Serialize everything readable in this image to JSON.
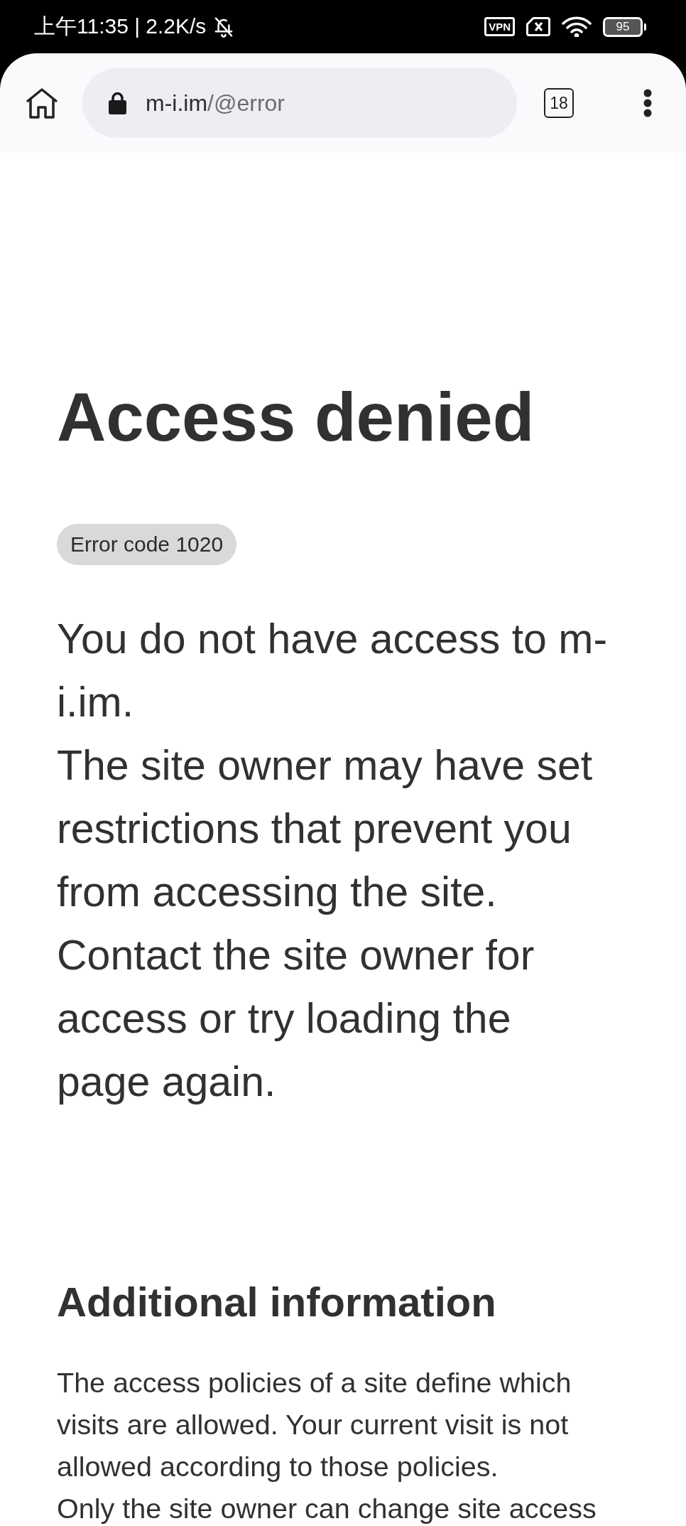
{
  "status_bar": {
    "time": "上午11:35 | 2.2K/s",
    "vpn_label": "VPN",
    "battery": "95"
  },
  "toolbar": {
    "url": {
      "host": "m-i.im",
      "path": "/@error"
    },
    "tab_count": "18"
  },
  "page": {
    "title": "Access denied",
    "error_code": "Error code 1020",
    "message": [
      "You do not have access to m-i.im.",
      "The site owner may have set restrictions that prevent you from accessing the site.",
      "Contact the site owner for access or try loading the page again."
    ]
  },
  "additional": {
    "heading": "Additional information",
    "paragraphs": [
      "The access policies of a site define which visits are allowed. Your current visit is not allowed according to those policies.",
      "Only the site owner can change site access"
    ]
  }
}
